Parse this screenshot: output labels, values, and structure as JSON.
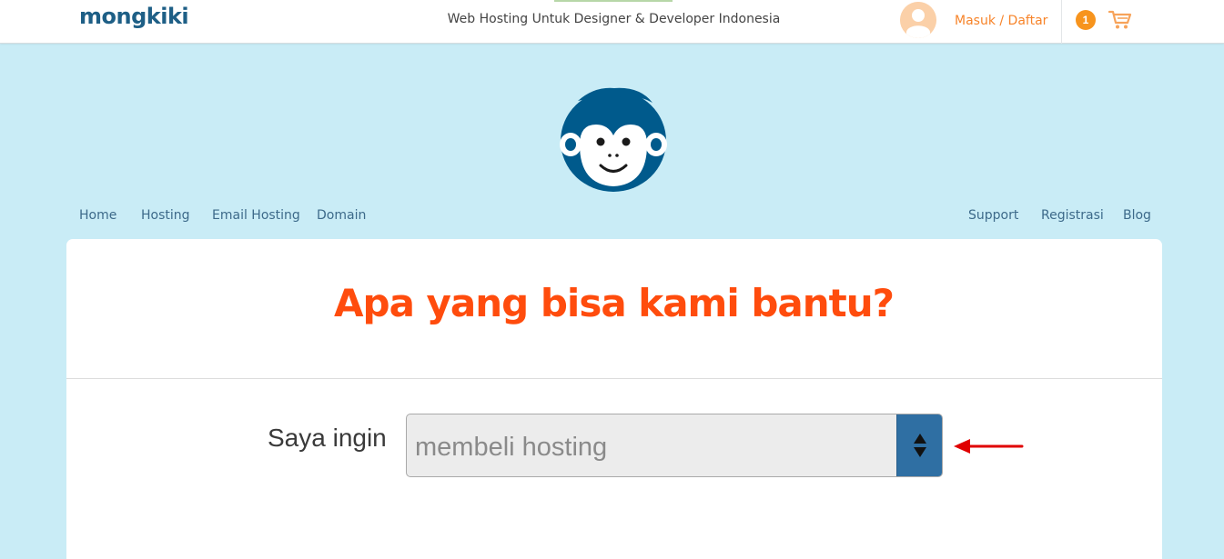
{
  "header": {
    "logo": "mongkiki",
    "tagline": "Web Hosting Untuk Designer & Developer Indonesia",
    "avatar_icon": "user-avatar-icon",
    "login_label": "Masuk / Daftar",
    "cart_count": "1",
    "cart_icon": "shopping-cart-icon"
  },
  "mascot_icon": "monkey-mascot-icon",
  "nav": {
    "left": [
      "Home",
      "Hosting",
      "Email Hosting",
      "Domain"
    ],
    "right": [
      "Support",
      "Registrasi",
      "Blog"
    ]
  },
  "card": {
    "title": "Apa yang bisa kami bantu?",
    "label": "Saya ingin",
    "select_value": "membeli hosting",
    "select_icon": "up-down-arrows-icon",
    "annotation_icon": "red-arrow-icon"
  },
  "colors": {
    "brand": "#1e5f86",
    "accent_orange": "#f7842a",
    "title_red": "#ff4c0d",
    "background": "#c9ecf6",
    "select_button": "#2f6fa3",
    "annotation_red": "#e00000"
  }
}
